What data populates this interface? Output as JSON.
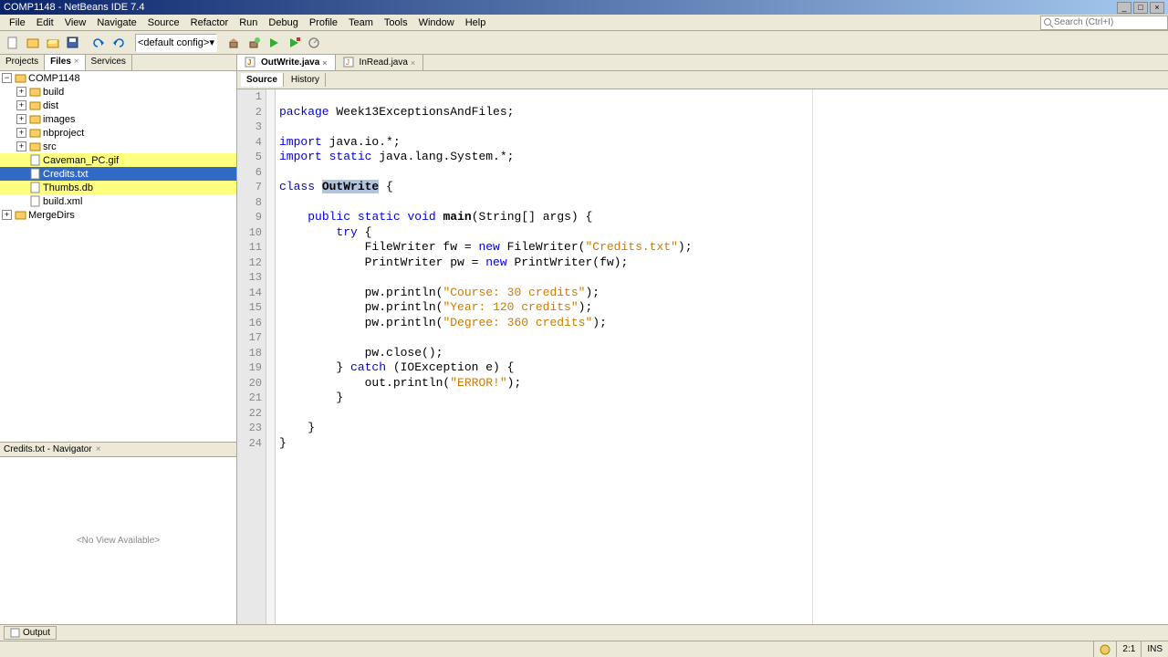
{
  "window": {
    "title": "COMP1148 - NetBeans IDE 7.4"
  },
  "menu": [
    "File",
    "Edit",
    "View",
    "Navigate",
    "Source",
    "Refactor",
    "Run",
    "Debug",
    "Profile",
    "Team",
    "Tools",
    "Window",
    "Help"
  ],
  "search_placeholder": "Search (Ctrl+I)",
  "config_combo": "<default config>",
  "side_tabs": [
    "Projects",
    "Files",
    "Services"
  ],
  "side_tabs_active": 1,
  "tree": {
    "root": "COMP1148",
    "items": [
      {
        "label": "build",
        "depth": 1,
        "icon": "folder"
      },
      {
        "label": "dist",
        "depth": 1,
        "icon": "folder"
      },
      {
        "label": "images",
        "depth": 1,
        "icon": "folder"
      },
      {
        "label": "nbproject",
        "depth": 1,
        "icon": "folder"
      },
      {
        "label": "src",
        "depth": 1,
        "icon": "folder"
      },
      {
        "label": "Caveman_PC.gif",
        "depth": 1,
        "icon": "file",
        "highlight": true
      },
      {
        "label": "Credits.txt",
        "depth": 1,
        "icon": "file",
        "selected": true,
        "highlight": true
      },
      {
        "label": "Thumbs.db",
        "depth": 1,
        "icon": "file",
        "highlight": true
      },
      {
        "label": "build.xml",
        "depth": 1,
        "icon": "file"
      }
    ],
    "root2": "MergeDirs"
  },
  "navigator": {
    "title": "Credits.txt - Navigator",
    "empty_text": "<No View Available>"
  },
  "editor_tabs": [
    {
      "label": "OutWrite.java",
      "active": true
    },
    {
      "label": "InRead.java",
      "active": false
    }
  ],
  "sub_tabs": [
    "Source",
    "History"
  ],
  "line_numbers": [
    "1",
    "2",
    "3",
    "4",
    "5",
    "6",
    "7",
    "8",
    "9",
    "10",
    "11",
    "12",
    "13",
    "14",
    "15",
    "16",
    "17",
    "18",
    "19",
    "20",
    "21",
    "22",
    "23",
    "24"
  ],
  "code": {
    "l1_kw": "package",
    "l1_rest": " Week13ExceptionsAndFiles;",
    "l3_kw": "import",
    "l3_rest": " java.io.*;",
    "l4_kw1": "import",
    "l4_kw2": "static",
    "l4_rest": " java.lang.System.*;",
    "l6_kw": "class",
    "l6_name": "OutWrite",
    "l6_brace": " {",
    "l8_pre": "    ",
    "l8_kw1": "public",
    "l8_kw2": "static",
    "l8_kw3": "void",
    "l8_main": "main",
    "l8_rest": "(String[] args) {",
    "l9": "        try {",
    "l9_kw": "try",
    "l10_pre": "            FileWriter fw = ",
    "l10_kw": "new",
    "l10_mid": " FileWriter(",
    "l10_str": "\"Credits.txt\"",
    "l10_end": ");",
    "l11_pre": "            PrintWriter pw = ",
    "l11_kw": "new",
    "l11_end": " PrintWriter(fw);",
    "l13_pre": "            pw.println(",
    "l13_str": "\"Course: 30 credits\"",
    "l13_end": ");",
    "l14_pre": "            pw.println(",
    "l14_str": "\"Year: 120 credits\"",
    "l14_end": ");",
    "l15_pre": "            pw.println(",
    "l15_str": "\"Degree: 360 credits\"",
    "l15_end": ");",
    "l17": "            pw.close();",
    "l18_pre": "        } ",
    "l18_kw": "catch",
    "l18_rest": " (IOException e) {",
    "l19_pre": "            out.println(",
    "l19_str": "\"ERROR!\"",
    "l19_end": ");",
    "l20": "        }",
    "l22": "    }",
    "l23": "}"
  },
  "output_tab": "Output",
  "status": {
    "pos": "2:1",
    "ins": "INS"
  }
}
